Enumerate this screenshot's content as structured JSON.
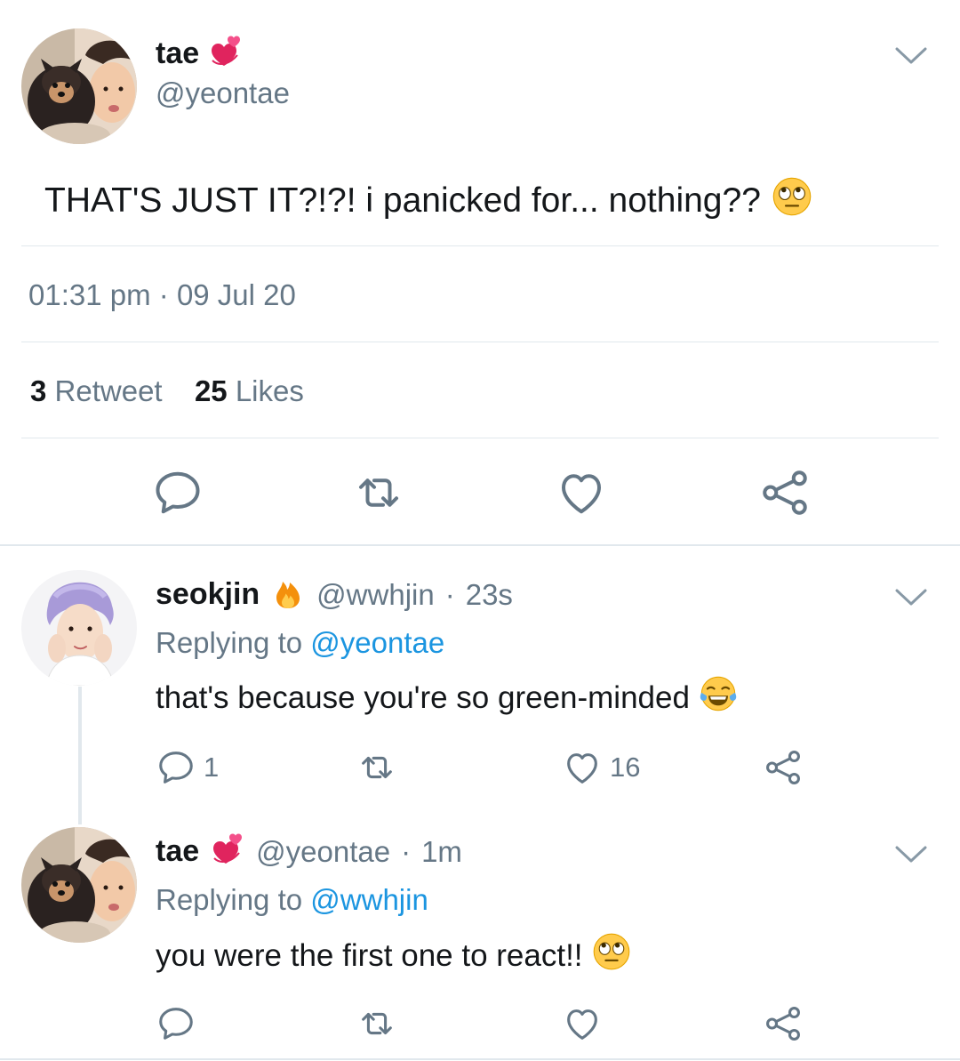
{
  "main_tweet": {
    "display_name": "tae",
    "handle": "@yeontae",
    "text": "THAT'S JUST IT?!?! i panicked for... nothing??",
    "time": "01:31 pm",
    "dot": "·",
    "date": "09 Jul 20",
    "retweets_count": "3",
    "retweets_label": "Retweet",
    "likes_count": "25",
    "likes_label": "Likes",
    "name_emoji": "revolving-hearts-icon",
    "text_emoji": "face-rolling-eyes-icon"
  },
  "replies": [
    {
      "display_name": "seokjin",
      "handle": "@wwhjin",
      "dot": "·",
      "age": "23s",
      "replying_label": "Replying to",
      "replying_to": "@yeontae",
      "text": "that's because you're so green-minded",
      "reply_count": "1",
      "like_count": "16",
      "name_emoji": "fire-icon",
      "text_emoji": "face-with-tears-of-joy-icon"
    },
    {
      "display_name": "tae",
      "handle": "@yeontae",
      "dot": "·",
      "age": "1m",
      "replying_label": "Replying to",
      "replying_to": "@wwhjin",
      "text": "you were the first one to react!!",
      "name_emoji": "revolving-hearts-icon",
      "text_emoji": "face-rolling-eyes-icon"
    }
  ],
  "colors": {
    "text": "#14171a",
    "muted": "#657786",
    "link": "#1b95e0",
    "divider": "#e1e8ed"
  }
}
